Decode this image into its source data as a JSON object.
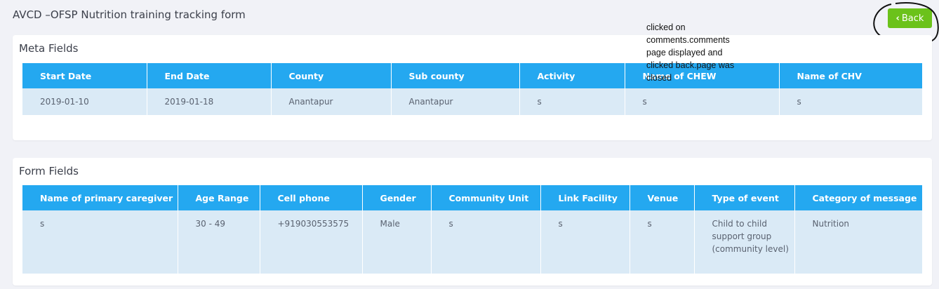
{
  "page": {
    "title": "AVCD –OFSP Nutrition training tracking form",
    "back_label": "Back",
    "accent_color": "#24a8f0",
    "back_color": "#6bc21a"
  },
  "annotation": {
    "note": "clicked on comments.comments page displayed and clicked back.page was closed"
  },
  "meta": {
    "title": "Meta Fields",
    "headers": [
      "Start Date",
      "End Date",
      "County",
      "Sub county",
      "Activity",
      "Name of CHEW",
      "Name of CHV"
    ],
    "row": [
      "2019-01-10",
      "2019-01-18",
      "Anantapur",
      "Anantapur",
      "s",
      "s",
      "s"
    ]
  },
  "form": {
    "title": "Form Fields",
    "headers": [
      "Name of primary caregiver",
      "Age Range",
      "Cell phone",
      "Gender",
      "Community Unit",
      "Link Facility",
      "Venue",
      "Type of event",
      "Category of message"
    ],
    "row": [
      "s",
      "30 - 49",
      "+919030553575",
      "Male",
      "s",
      "s",
      "s",
      "Child to child support group (community level)",
      "Nutrition"
    ]
  }
}
